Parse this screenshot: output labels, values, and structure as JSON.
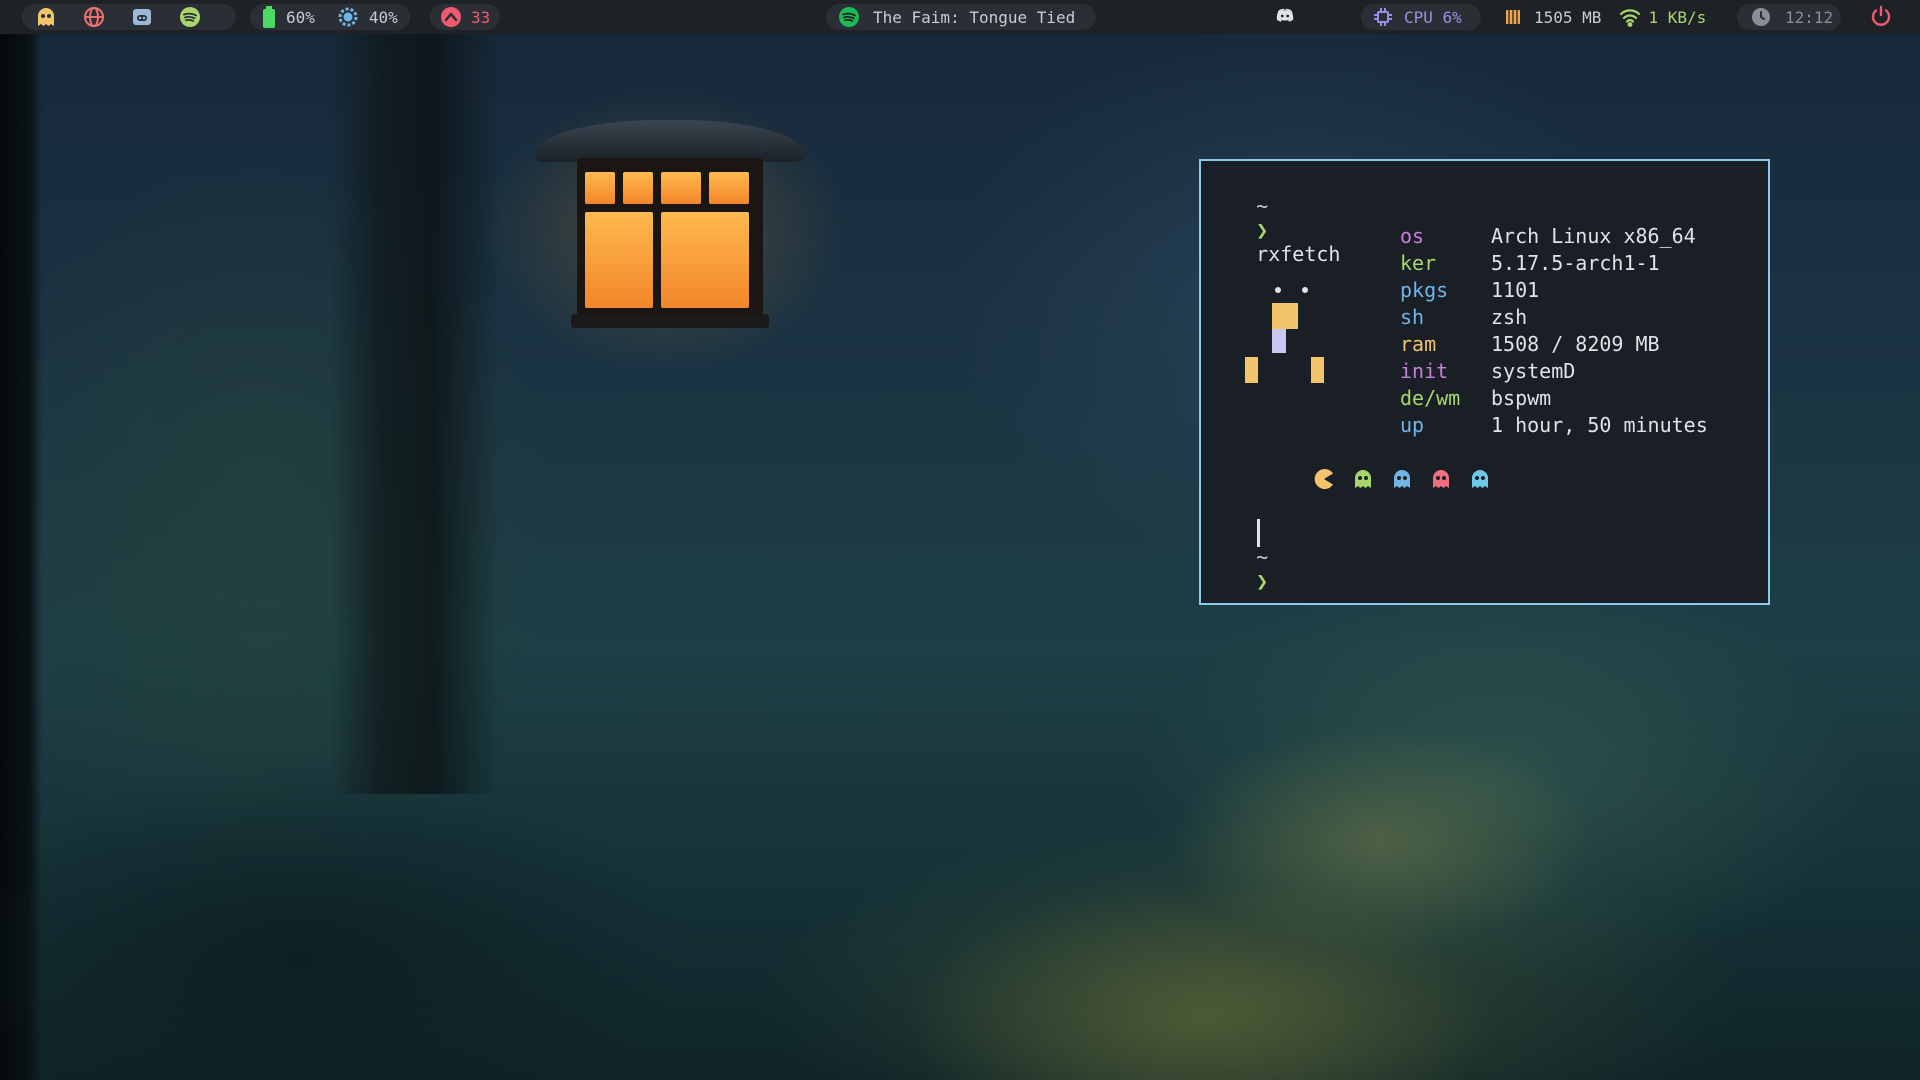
{
  "colors": {
    "bar_bg": "#1e2227",
    "pill_bg": "#2a2f35",
    "terminal_bg": "#1a1f26",
    "terminal_border": "#8ec7e8",
    "text": "#dfe3e8",
    "green": "#a8d66a",
    "yellow": "#f2c46b",
    "blue": "#6fb5e6",
    "magenta": "#c77fdc",
    "red": "#ef5a6f",
    "spotify_green": "#1db954",
    "battery_green": "#4cd964"
  },
  "topbar": {
    "workspaces": [
      {
        "icon": "ghost-icon",
        "color": "#f2c46b"
      },
      {
        "icon": "globe-icon",
        "color": "#ef6f6f"
      },
      {
        "icon": "discord-icon",
        "color": "#9bb8d8"
      },
      {
        "icon": "spotify-icon",
        "color": "#a8d66a"
      }
    ],
    "battery": "60%",
    "brightness": "40%",
    "updates": "33",
    "now_playing": "The Faim: Tongue Tied",
    "cpu": "CPU 6%",
    "memory": "1505 MB",
    "network": "1 KB/s",
    "clock": "12:12"
  },
  "terminal": {
    "prompt_tilde": "~",
    "prompt_arrow": "❯",
    "command": "rxfetch",
    "info": [
      {
        "key": "os",
        "value": "Arch Linux x86_64",
        "color": "#c77fdc"
      },
      {
        "key": "ker",
        "value": "5.17.5-arch1-1",
        "color": "#a8d66a"
      },
      {
        "key": "pkgs",
        "value": "1101",
        "color": "#6fb5e6"
      },
      {
        "key": "sh",
        "value": "zsh",
        "color": "#6fb5e6"
      },
      {
        "key": "ram",
        "value": "1508 / 8209 MB",
        "color": "#f2c46b"
      },
      {
        "key": "init",
        "value": "systemD",
        "color": "#c77fdc"
      },
      {
        "key": "de/wm",
        "value": "bspwm",
        "color": "#a8d66a"
      },
      {
        "key": "up",
        "value": "1 hour, 50 minutes",
        "color": "#6fb5e6"
      }
    ],
    "palette": [
      {
        "icon": "pacman-icon",
        "color": "#f2c46b"
      },
      {
        "icon": "ghost-icon",
        "color": "#a8d66a"
      },
      {
        "icon": "ghost-icon",
        "color": "#6fb5e6"
      },
      {
        "icon": "ghost-icon",
        "color": "#ef6f7f"
      },
      {
        "icon": "ghost-icon",
        "color": "#6fc7e6"
      }
    ]
  }
}
